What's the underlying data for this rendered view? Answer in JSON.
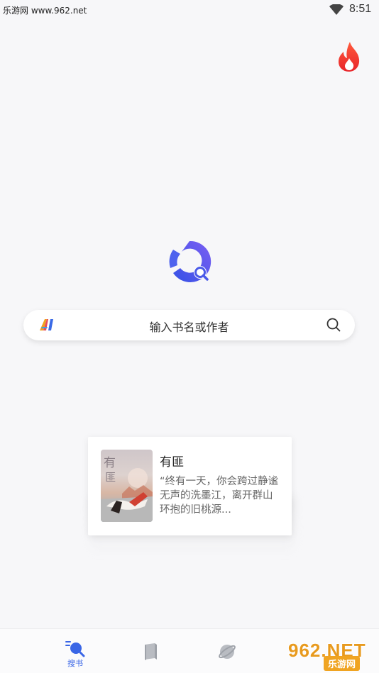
{
  "status_bar": {
    "watermark_text": "乐游网 www.962.net",
    "time": "8:51"
  },
  "header": {
    "hot_icon": "flame-icon"
  },
  "logo": {
    "icon": "app-logo-search-icon",
    "colors": [
      "#3d5ae8",
      "#7a5cf0"
    ]
  },
  "search": {
    "ai_badge": "AI",
    "placeholder": "输入书名或作者",
    "icon": "search-icon"
  },
  "recommendation": {
    "title": "有匪",
    "description": "“终有一天，你会跨过静谧无声的洗墨江，离开群山环抱的旧桃源...",
    "cover_text": "有匪"
  },
  "bottom_nav": {
    "items": [
      {
        "label": "搜书",
        "icon": "search-book-icon",
        "active": true
      },
      {
        "label": "",
        "icon": "book-icon",
        "active": false
      },
      {
        "label": "",
        "icon": "planet-icon",
        "active": false
      }
    ],
    "accent": "#3a66e6"
  },
  "watermark": {
    "main": "962.NET",
    "sub": "乐游网"
  }
}
